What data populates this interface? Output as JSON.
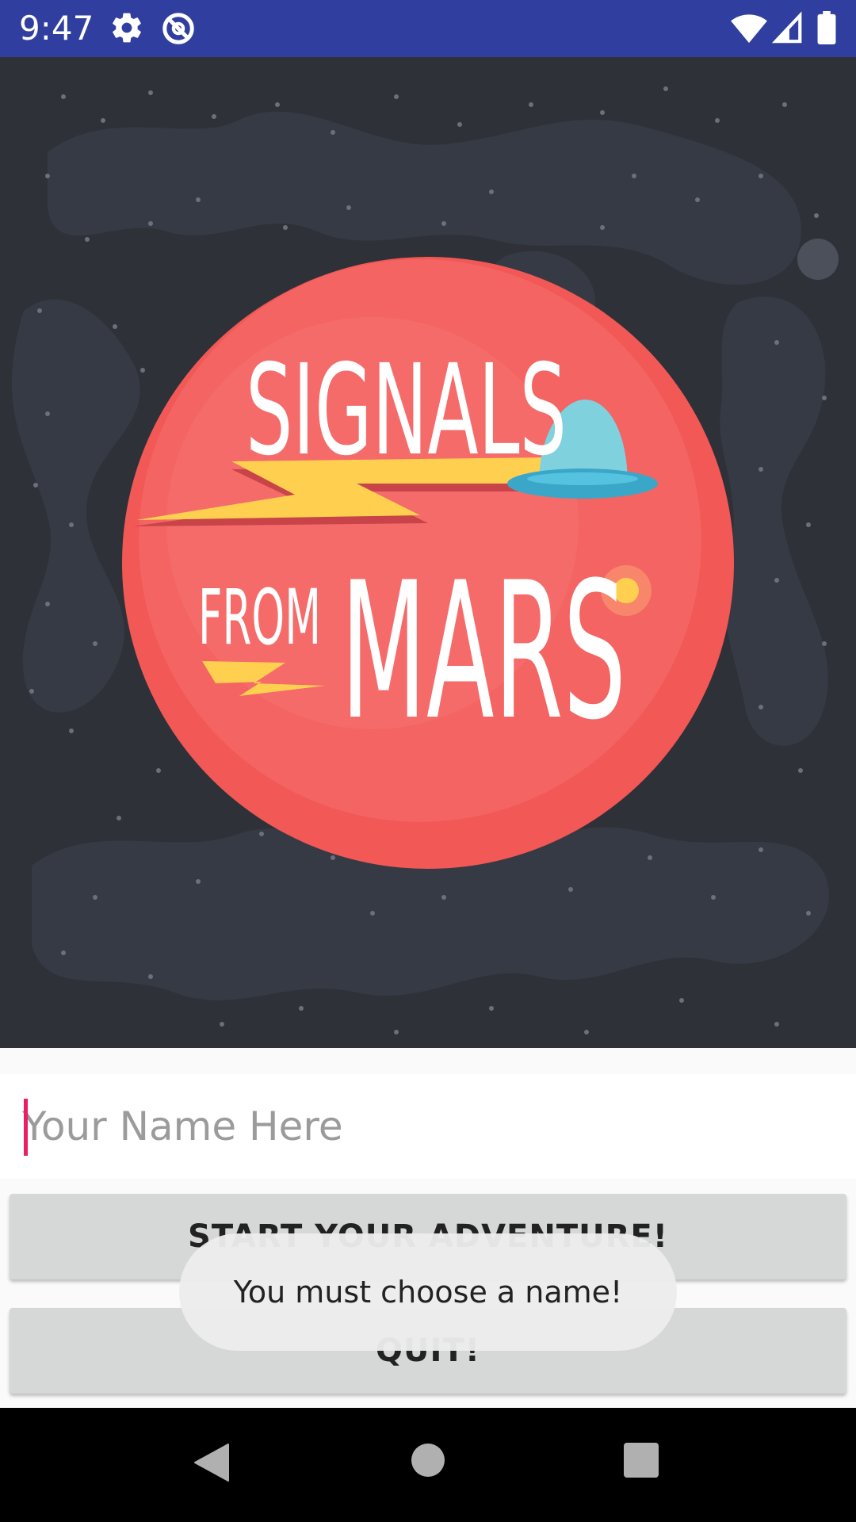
{
  "status_bar": {
    "time": "9:47",
    "icons": [
      "gear-icon",
      "data-saver-icon",
      "wifi-icon",
      "signal-icon",
      "battery-icon"
    ]
  },
  "hero": {
    "title_line1": "SIGNALS",
    "title_word_from": "FROM",
    "title_word_mars": "MARS",
    "colors": {
      "background": "#2e3138",
      "planet": "#f25f5c",
      "bolt": "#ffd04f",
      "ufo_dome": "#7fd1de",
      "ufo_saucer": "#3aa7c9"
    }
  },
  "name_field": {
    "placeholder": "Your Name Here",
    "value": ""
  },
  "buttons": {
    "start_label": "START YOUR ADVENTURE!",
    "quit_label": "QUIT!"
  },
  "toast": {
    "message": "You must choose a name!"
  },
  "nav_bar": {
    "icons": [
      "back-icon",
      "home-icon",
      "recents-icon"
    ]
  }
}
